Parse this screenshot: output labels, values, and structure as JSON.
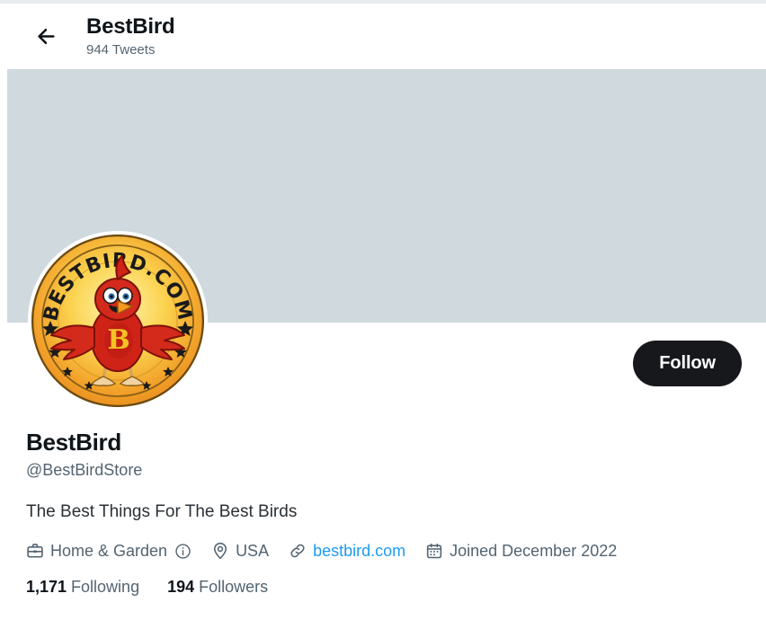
{
  "colors": {
    "banner": "#cfd9de",
    "follow_button_bg": "#16181b",
    "follow_button_text": "#ffffff",
    "link_blue": "#1d9bf0",
    "secondary_text": "#536471",
    "primary_text": "#0f1419",
    "top_strip": "#e9ecef"
  },
  "header": {
    "back_icon": "arrow-left-icon",
    "title": "BestBird",
    "tweet_count": "944 Tweets"
  },
  "banner": {
    "alt": "empty profile banner"
  },
  "avatar": {
    "alt": "BestBird.com logo: red cardinal bird on a gold coin badge",
    "badge_text": "BESTBIRD.COM",
    "chest_letter": "B"
  },
  "actions": {
    "follow_label": "Follow"
  },
  "profile": {
    "display_name": "BestBird",
    "handle": "@BestBirdStore",
    "bio": "The Best Things For The Best Birds"
  },
  "meta": {
    "category_icon": "briefcase-icon",
    "category": "Home & Garden",
    "category_info_icon": "info-circle-icon",
    "location_icon": "map-pin-icon",
    "location": "USA",
    "link_icon": "link-icon",
    "website": "bestbird.com",
    "joined_icon": "calendar-icon",
    "joined": "Joined December 2022"
  },
  "stats": {
    "following_count": "1,171",
    "following_label": "Following",
    "followers_count": "194",
    "followers_label": "Followers"
  }
}
